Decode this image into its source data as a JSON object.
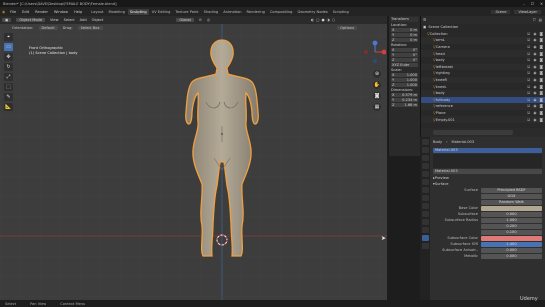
{
  "titlebar": {
    "text": "Blender* [C:\\Users\\DAVE\\Desktop\\FEMALE BODY\\Female.blend]"
  },
  "menu": [
    "File",
    "Edit",
    "Render",
    "Window",
    "Help"
  ],
  "workspaces": [
    "Layout",
    "Modeling",
    "Sculpting",
    "UV Editing",
    "Texture Paint",
    "Shading",
    "Animation",
    "Rendering",
    "Compositing",
    "Geometry Nodes",
    "Scripting"
  ],
  "active_workspace": "Sculpting",
  "scene": {
    "scene_label": "Scene",
    "viewlayer_label": "ViewLayer"
  },
  "viewport": {
    "mode": "Object Mode",
    "menus": [
      "View",
      "Select",
      "Add",
      "Object"
    ],
    "transform": "Global",
    "options_label": "Options",
    "orientation_label": "Orientation:",
    "orientation_value": "Default",
    "drag_label": "Drag:",
    "drag_value": "Select Box",
    "info_line1": "Front Orthographic",
    "info_line2": "(1) Scene Collection | body"
  },
  "toolbar": {
    "icons": [
      "cursor-icon",
      "select-box-icon",
      "move-icon",
      "rotate-icon",
      "scale-icon",
      "transform-icon",
      "annotate-icon",
      "measure-icon"
    ]
  },
  "npanel": {
    "title": "Transform",
    "location_label": "Location:",
    "location": [
      {
        "axis": "X",
        "val": "0 m"
      },
      {
        "axis": "Y",
        "val": "0 m"
      },
      {
        "axis": "Z",
        "val": "0 m"
      }
    ],
    "rotation_label": "Rotation:",
    "rotation": [
      {
        "axis": "X",
        "val": "0°"
      },
      {
        "axis": "Y",
        "val": "0°"
      },
      {
        "axis": "Z",
        "val": "0°"
      }
    ],
    "rotmode": "XYZ Euler",
    "scale_label": "Scale:",
    "scale": [
      {
        "axis": "X",
        "val": "1.000"
      },
      {
        "axis": "Y",
        "val": "1.000"
      },
      {
        "axis": "Z",
        "val": "1.000"
      }
    ],
    "dimensions_label": "Dimensions:",
    "dimensions": [
      {
        "axis": "X",
        "val": "0.579 m"
      },
      {
        "axis": "Y",
        "val": "0.234 m"
      },
      {
        "axis": "Z",
        "val": "1.66 m"
      }
    ]
  },
  "outliner": {
    "title": "Scene Collection",
    "rows": [
      "Collection",
      "armL",
      "Camera",
      "head",
      "body",
      "leftbreast",
      "rightleg",
      "kneeR",
      "kneeL",
      "body",
      "fullbody",
      "reference",
      "Plane",
      "Empty.001"
    ],
    "selected_index": 10
  },
  "properties": {
    "object_name": "Body",
    "material_label": "Material.003",
    "slot_name": "Material.003",
    "material_name": "Material.003",
    "preview_label": "Preview",
    "surface_label": "Surface",
    "rows": [
      {
        "label": "Surface",
        "value": "Principled BSDF"
      },
      {
        "label": "",
        "value": "GGX"
      },
      {
        "label": "",
        "value": "Random Walk"
      },
      {
        "label": "Base Color",
        "value": ""
      },
      {
        "label": "Subsurface",
        "value": "0.000"
      },
      {
        "label": "Subsurface Radius",
        "value": "1.000"
      },
      {
        "label": "",
        "value": "0.200"
      },
      {
        "label": "",
        "value": "0.100"
      },
      {
        "label": "Subsurface Color",
        "value": ""
      },
      {
        "label": "Subsurface IOR",
        "value": "1.400"
      },
      {
        "label": "Subsurface Anisotr..",
        "value": "0.000"
      },
      {
        "label": "Metallic",
        "value": "0.000"
      }
    ],
    "colors": {
      "base": "#b0a692",
      "subsurface": "#e07a78"
    }
  },
  "footer": [
    "Select",
    "Pan View",
    "Context Menu"
  ],
  "watermark": "Udemy"
}
